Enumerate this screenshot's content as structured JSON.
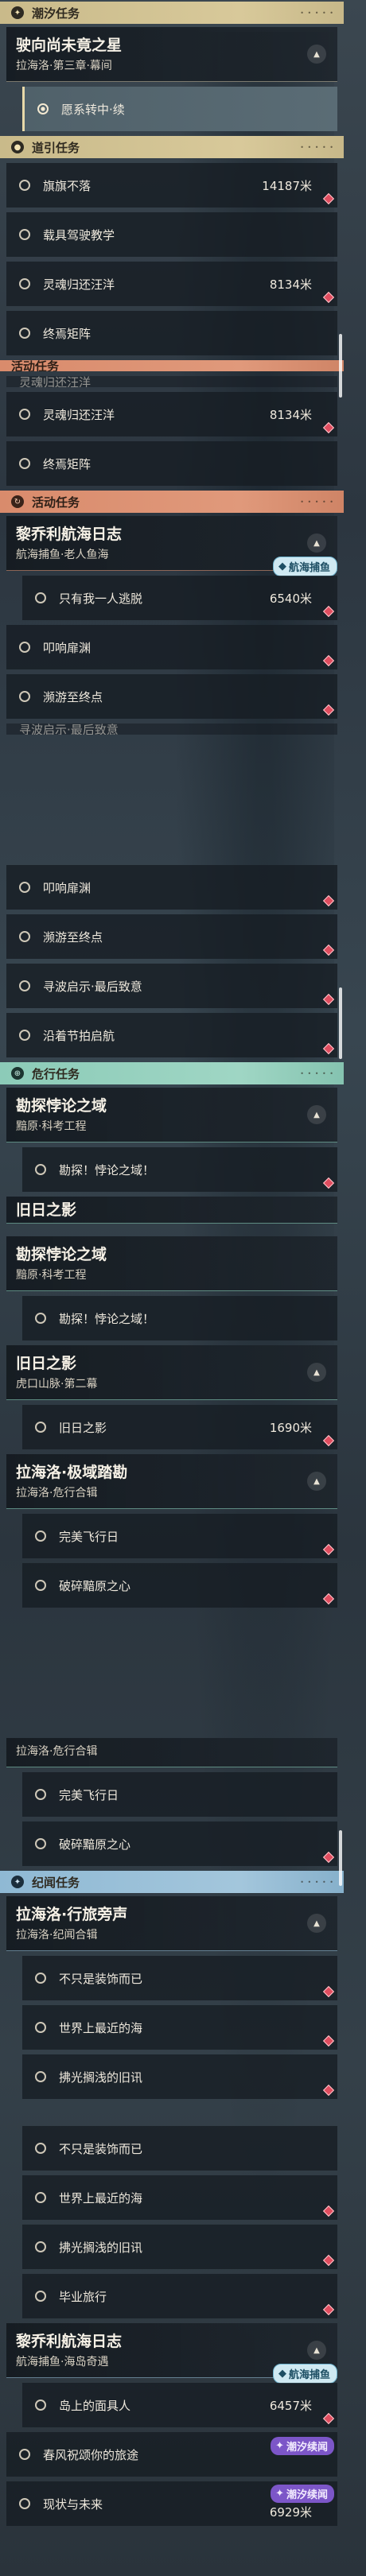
{
  "panel1": {
    "tide": {
      "label": "潮汐任务",
      "quest_title": "驶向尚未竟之星",
      "quest_sub": "拉海洛·第三章·幕间",
      "active_step": "愿系转中·续"
    },
    "guide": {
      "label": "道引任务",
      "items": [
        {
          "label": "旗旗不落",
          "dist": "14187米"
        },
        {
          "label": "载具驾驶教学",
          "dist": ""
        },
        {
          "label": "灵魂归还汪洋",
          "dist": "8134米"
        },
        {
          "label": "终焉矩阵",
          "dist": ""
        }
      ]
    },
    "scrolled": {
      "cat_label": "活动任务",
      "ghost_item": "灵魂归还汪洋",
      "items": [
        {
          "label": "灵魂归还汪洋",
          "dist": "8134米"
        },
        {
          "label": "终焉矩阵",
          "dist": ""
        }
      ]
    },
    "activity": {
      "label": "活动任务",
      "quest_title": "黎乔利航海日志",
      "quest_sub": "航海捕鱼·老人鱼海",
      "badge": "航海捕鱼",
      "items": [
        {
          "label": "只有我一人逃脱",
          "dist": "6540米"
        },
        {
          "label": "叩响扉渊",
          "dist": ""
        },
        {
          "label": "濒游至终点",
          "dist": ""
        }
      ],
      "ghost_item": "寻波启示·最后致意"
    }
  },
  "panel2": {
    "items": [
      {
        "label": "叩响扉渊"
      },
      {
        "label": "濒游至终点"
      },
      {
        "label": "寻波启示·最后致意"
      },
      {
        "label": "沿着节拍启航"
      }
    ],
    "danger": {
      "label": "危行任务",
      "quests": [
        {
          "title": "勘探悖论之域",
          "sub": "黯原·科考工程",
          "step": "勘探！悖论之域！"
        },
        {
          "title": "旧日之影",
          "sub": "",
          "step": ""
        },
        {
          "title": "勘探悖论之域",
          "sub": "黯原·科考工程",
          "step": "勘探！悖论之域！"
        },
        {
          "title": "旧日之影",
          "sub": "虎口山脉·第二幕",
          "step": "旧日之影",
          "dist": "1690米"
        },
        {
          "title": "拉海洛·极域踏勘",
          "sub": "拉海洛·危行合辑",
          "steps": [
            "完美飞行日",
            "破碎黯原之心"
          ]
        }
      ]
    }
  },
  "panel3": {
    "top": {
      "sub": "拉海洛·危行合辑",
      "steps": [
        "完美飞行日",
        "破碎黯原之心"
      ]
    },
    "record": {
      "label": "纪闻任务",
      "quest_title": "拉海洛·行旅旁声",
      "quest_sub": "拉海洛·纪闻合辑",
      "items": [
        {
          "label": "不只是装饰而已"
        },
        {
          "label": "世界上最近的海"
        },
        {
          "label": "拂光搁浅的旧讯"
        }
      ]
    },
    "repeat_items": [
      {
        "label": "不只是装饰而已"
      },
      {
        "label": "世界上最近的海"
      },
      {
        "label": "拂光搁浅的旧讯"
      },
      {
        "label": "毕业旅行"
      }
    ],
    "voyage": {
      "quest_title": "黎乔利航海日志",
      "quest_sub": "航海捕鱼·海岛奇遇",
      "badge": "航海捕鱼",
      "items": [
        {
          "label": "岛上的面具人",
          "dist": "6457米",
          "badge": ""
        },
        {
          "label": "春风祝颂你的旅途",
          "dist": "",
          "badge": "潮汐续闻"
        },
        {
          "label": "现状与未来",
          "dist": "6929米",
          "badge": "潮汐续闻"
        }
      ]
    }
  }
}
